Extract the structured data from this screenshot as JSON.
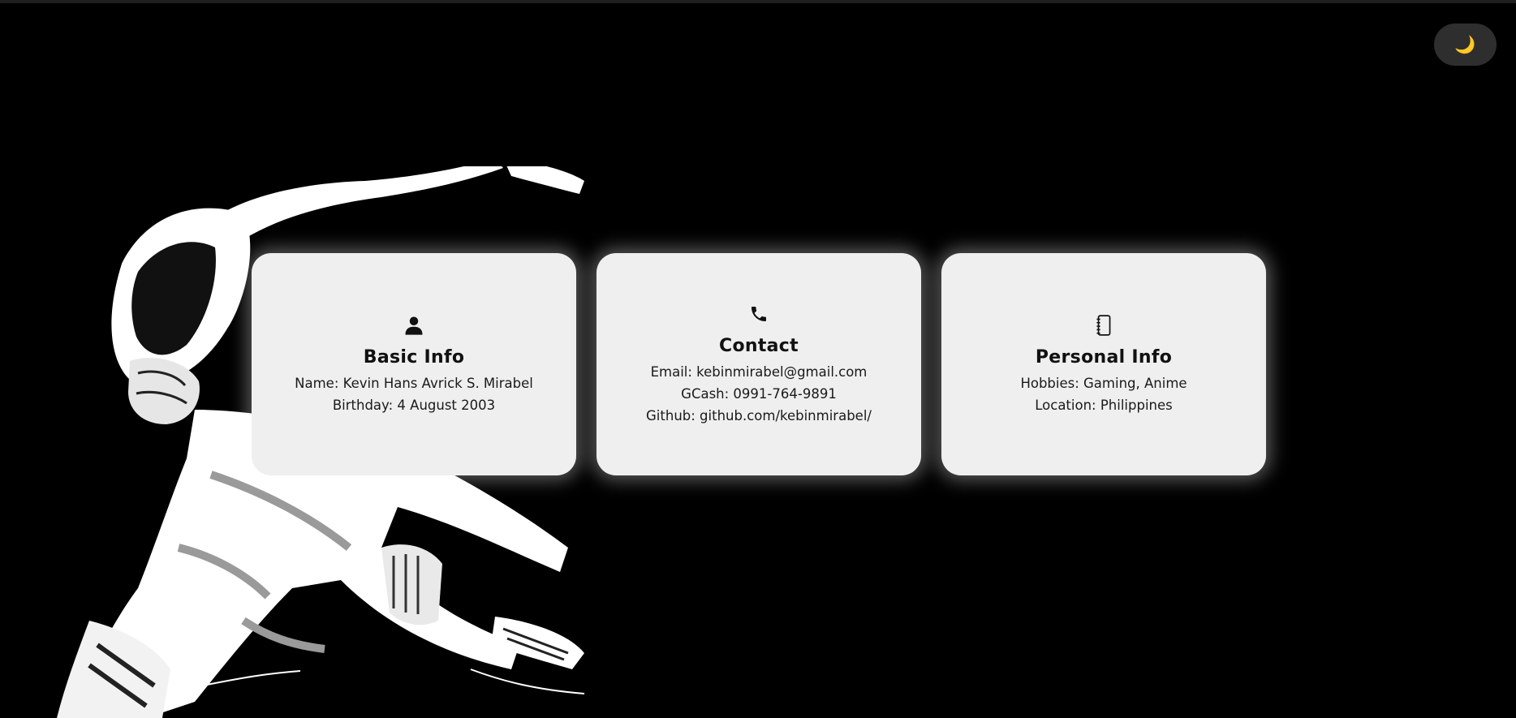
{
  "theme_toggle": {
    "icon": "moon-icon",
    "glyph": "🌙"
  },
  "cards": {
    "basic": {
      "icon": "person-icon",
      "title": "Basic Info",
      "lines": [
        "Name: Kevin Hans Avrick S. Mirabel",
        "Birthday: 4 August 2003"
      ]
    },
    "contact": {
      "icon": "phone-icon",
      "title": "Contact",
      "lines": [
        "Email: kebinmirabel@gmail.com",
        "GCash: 0991-764-9891",
        "Github: github.com/kebinmirabel/"
      ]
    },
    "personal": {
      "icon": "notebook-icon",
      "title": "Personal Info",
      "lines": [
        "Hobbies: Gaming, Anime",
        "Location: Philippines"
      ]
    }
  },
  "colors": {
    "background": "#000000",
    "card": "#efefef",
    "toggle": "#2e2e2e",
    "moon": "#f3c33a"
  }
}
